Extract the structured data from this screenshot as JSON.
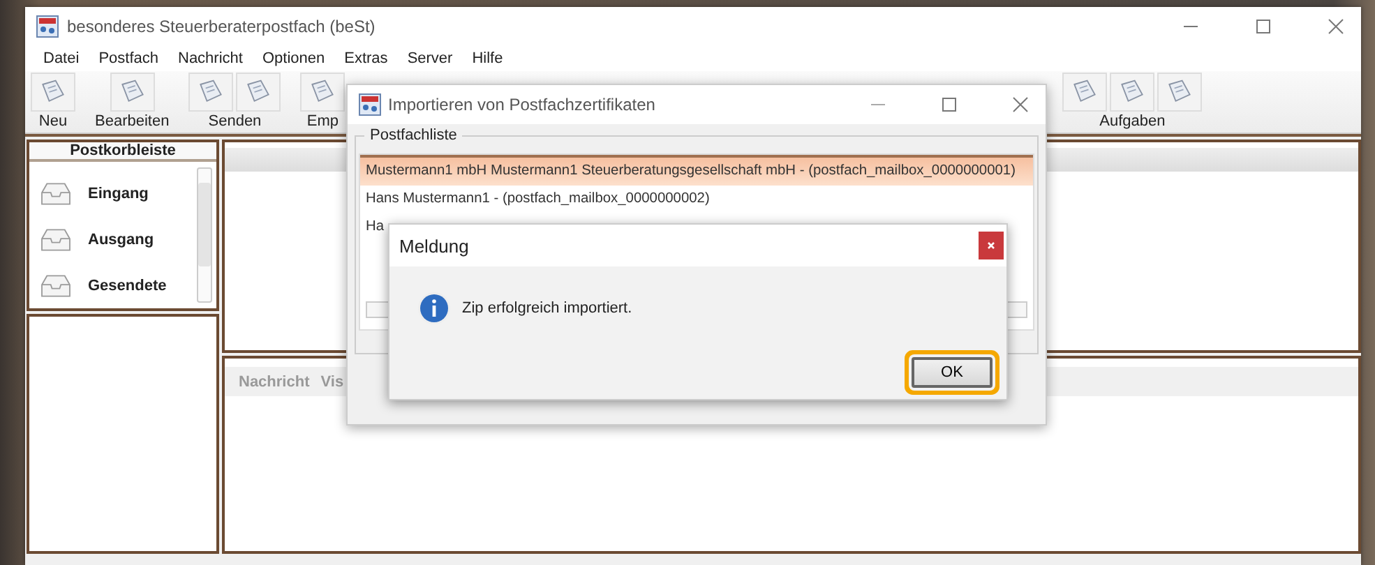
{
  "window": {
    "title": "besonderes Steuerberaterpostfach (beSt)"
  },
  "menu": [
    "Datei",
    "Postfach",
    "Nachricht",
    "Optionen",
    "Extras",
    "Server",
    "Hilfe"
  ],
  "toolbar": [
    {
      "label": "Neu",
      "kind": "single"
    },
    {
      "label": "Bearbeiten",
      "kind": "single"
    },
    {
      "label": "Senden",
      "kind": "pair"
    },
    {
      "label": "Emp",
      "kind": "single"
    },
    {
      "label": "Aufgaben",
      "kind": "triple"
    }
  ],
  "sidebar": {
    "title": "Postkorbleiste",
    "items": [
      "Eingang",
      "Ausgang",
      "Gesendete"
    ]
  },
  "message_tabs": [
    "Nachricht",
    "Vis"
  ],
  "import_dialog": {
    "title": "Importieren von Postfachzertifikaten",
    "group_label": "Postfachliste",
    "rows": [
      {
        "label": "Mustermann1 mbH Mustermann1 Steuerberatungsgesellschaft mbH - (postfach_mailbox_0000000001)",
        "selected": true
      },
      {
        "label": "Hans Mustermann1 - (postfach_mailbox_0000000002)",
        "selected": false
      },
      {
        "label": "Ha",
        "selected": false
      }
    ]
  },
  "message_dialog": {
    "title": "Meldung",
    "text": "Zip erfolgreich importiert.",
    "button": {
      "label": "OK",
      "focused": true
    }
  }
}
